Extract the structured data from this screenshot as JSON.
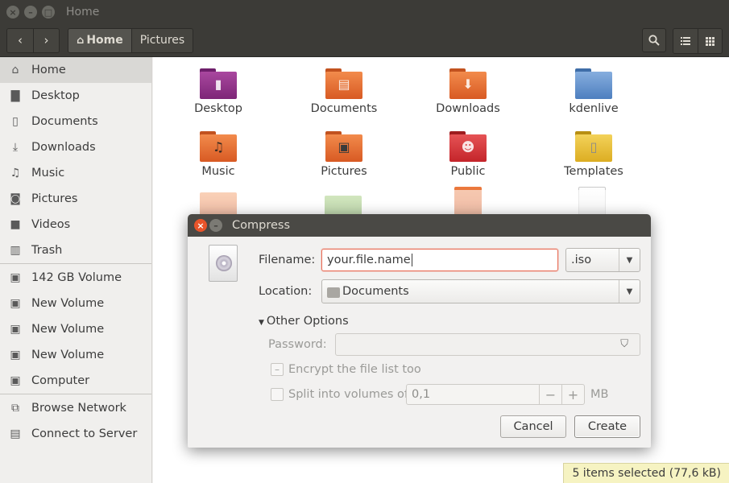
{
  "window": {
    "title": "Home"
  },
  "toolbar": {
    "back_glyph": "‹",
    "forward_glyph": "›",
    "breadcrumbs": [
      {
        "label": "Home",
        "icon": "home-icon"
      },
      {
        "label": "Pictures"
      }
    ],
    "search_icon": "search-icon",
    "view_list_icon": "list-icon",
    "view_grid_icon": "grid-icon"
  },
  "sidebar": {
    "items": [
      {
        "label": "Home",
        "icon": "home-icon"
      },
      {
        "label": "Desktop",
        "icon": "desktop-icon"
      },
      {
        "label": "Documents",
        "icon": "document-icon"
      },
      {
        "label": "Downloads",
        "icon": "download-icon"
      },
      {
        "label": "Music",
        "icon": "music-icon"
      },
      {
        "label": "Pictures",
        "icon": "camera-icon"
      },
      {
        "label": "Videos",
        "icon": "video-icon"
      },
      {
        "label": "Trash",
        "icon": "trash-icon"
      },
      {
        "label": "142 GB Volume",
        "icon": "drive-icon"
      },
      {
        "label": "New Volume",
        "icon": "drive-icon"
      },
      {
        "label": "New Volume",
        "icon": "drive-icon"
      },
      {
        "label": "New Volume",
        "icon": "drive-icon"
      },
      {
        "label": "Computer",
        "icon": "drive-icon"
      },
      {
        "label": "Browse Network",
        "icon": "network-icon"
      },
      {
        "label": "Connect to Server",
        "icon": "server-icon"
      }
    ]
  },
  "files": {
    "items": [
      {
        "label": "Desktop",
        "color": "#8a2b86"
      },
      {
        "label": "Documents",
        "color": "#e2682f"
      },
      {
        "label": "Downloads",
        "color": "#e2682f"
      },
      {
        "label": "kdenlive",
        "color": "#5b86bd"
      },
      {
        "label": "Music",
        "color": "#e2682f"
      },
      {
        "label": "Pictures",
        "color": "#e2682f"
      },
      {
        "label": "Public",
        "color": "#c9272a"
      },
      {
        "label": "Templates",
        "color": "#e0b321"
      }
    ]
  },
  "dialog": {
    "title": "Compress",
    "filename_label": "Filename:",
    "filename_value": "your.file.name",
    "extension_value": ".iso",
    "location_label": "Location:",
    "location_value": "Documents",
    "other_options_label": "Other Options",
    "password_label": "Password:",
    "encrypt_label": "Encrypt the file list too",
    "split_label": "Split into volumes of",
    "split_value": "0,1",
    "split_unit": "MB",
    "cancel_label": "Cancel",
    "create_label": "Create"
  },
  "status": {
    "text": "5 items selected  (77,6 kB)"
  }
}
